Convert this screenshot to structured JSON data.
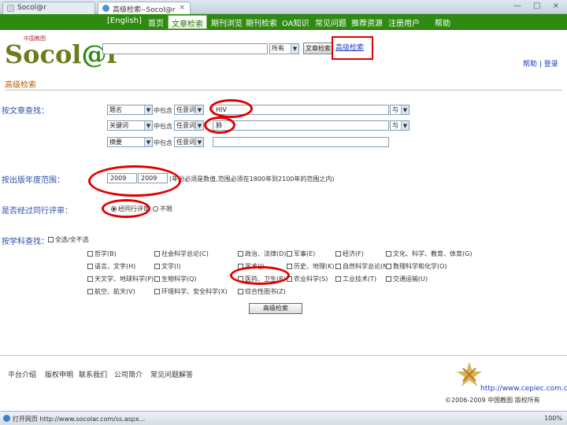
{
  "browser": {
    "tabs": [
      {
        "title": "Socol@r"
      },
      {
        "title": "高级检索--Socol@r"
      }
    ],
    "window_controls": "— □ ×",
    "status_text": "打开网页 http://www.socolar.com/ss.aspx...",
    "zoom": "100%"
  },
  "nav": {
    "items": [
      "[English]",
      "首页",
      "文章检索",
      "期刊浏览",
      "期刊检索",
      "OA知识",
      "常见问题",
      "推荐资源",
      "注册用户",
      "帮助"
    ]
  },
  "header": {
    "logo_main": "Socol",
    "logo_at": "@",
    "logo_end": "r",
    "logo_tag": "中国教图",
    "search_placeholder": "",
    "scope_value": "所有",
    "quick_search_label": "文章检索",
    "advanced_search_link": "高级检索",
    "top_links": "帮助 | 登录"
  },
  "page": {
    "heading": "高级检索"
  },
  "article_search": {
    "label": "按文章查找：",
    "rows": [
      {
        "field": "题名",
        "match_label": "中包含",
        "match_mode": "任意词",
        "value": "HIV",
        "logic": "与"
      },
      {
        "field": "关键词",
        "match_label": "中包含",
        "match_mode": "任意词",
        "value": "肺",
        "logic": "与"
      },
      {
        "field": "摘要",
        "match_label": "中包含",
        "match_mode": "任意词",
        "value": "",
        "logic": ""
      }
    ]
  },
  "year": {
    "label": "按出版年度范围：",
    "from": "2009",
    "to": "2009",
    "hint": "(年份必须是数值,范围必须在1800年到2100年的范围之内)"
  },
  "peer_review": {
    "label": "是否经过同行评审：",
    "options": [
      "经同行评审",
      "不限"
    ],
    "selected": "经同行评审"
  },
  "subject": {
    "label": "按学科查找：",
    "select_all_label": "全选/全不选",
    "items": [
      "哲学(B)",
      "社会科学总论(C)",
      "政治、法律(D)",
      "军事(E)",
      "经济(F)",
      "文化、科学、教育、体育(G)",
      "语言、文字(H)",
      "文学(I)",
      "艺术(J)",
      "历史、地理(K)",
      "自然科学总论(N)",
      "数理科学和化学(O)",
      "天文学、地球科学(P)",
      "生物科学(Q)",
      "医药、卫生(R)",
      "农业科学(S)",
      "工业技术(T)",
      "交通运输(U)",
      "航空、航天(V)",
      "环境科学、安全科学(X)",
      "综合性图书(Z)"
    ],
    "search_button": "高级检索"
  },
  "footer": {
    "links": [
      "平台介绍",
      "版权申明",
      "联系我们",
      "公司简介",
      "常见问题解答"
    ],
    "url": "http://www.cepiec.com.cn",
    "copyright": "©2006-2009 中国教图 版权所有"
  }
}
